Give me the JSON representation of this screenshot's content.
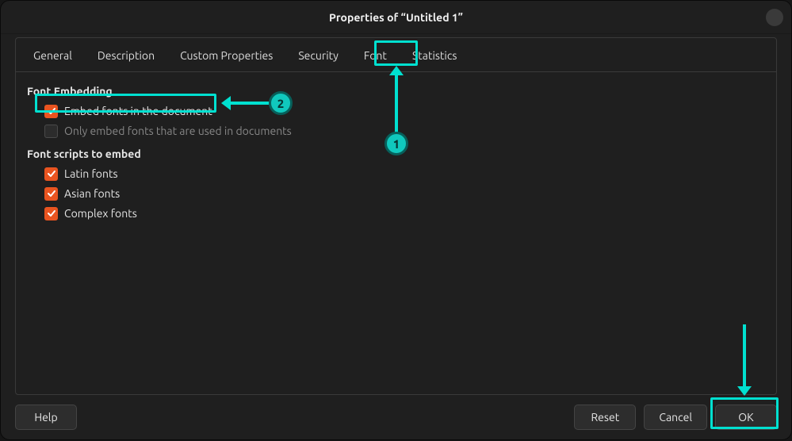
{
  "title": "Properties of “Untitled 1”",
  "tabs": [
    {
      "label": "General"
    },
    {
      "label": "Description"
    },
    {
      "label": "Custom Properties"
    },
    {
      "label": "Security"
    },
    {
      "label": "Font"
    },
    {
      "label": "Statistics"
    }
  ],
  "sections": {
    "embedding": {
      "title": "Font Embedding",
      "opts": [
        {
          "label": "Embed fonts in the document",
          "checked": true,
          "disabled": false
        },
        {
          "label": "Only embed fonts that are used in documents",
          "checked": false,
          "disabled": true
        }
      ]
    },
    "scripts": {
      "title": "Font scripts to embed",
      "opts": [
        {
          "label": "Latin fonts",
          "checked": true
        },
        {
          "label": "Asian fonts",
          "checked": true
        },
        {
          "label": "Complex fonts",
          "checked": true
        }
      ]
    }
  },
  "buttons": {
    "help": "Help",
    "reset": "Reset",
    "cancel": "Cancel",
    "ok": "OK"
  },
  "annotations": {
    "badge1": "1",
    "badge2": "2"
  }
}
